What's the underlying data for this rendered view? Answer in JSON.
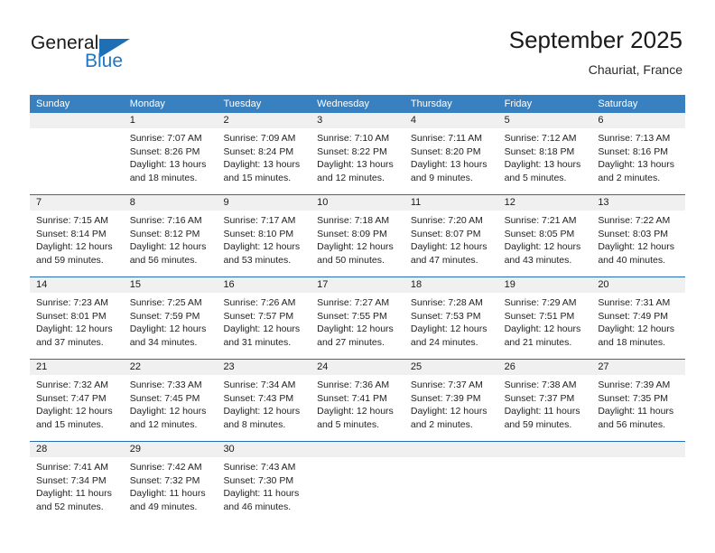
{
  "brand": {
    "name_top": "General",
    "name_bottom": "Blue",
    "triangle_icon": "blue-triangle-icon",
    "accent_color": "#2076c4"
  },
  "header": {
    "title": "September 2025",
    "subtitle": "Chauriat, France"
  },
  "theme": {
    "header_blue": "#3880c0",
    "row_divider_blue": "#2a6db1",
    "daynum_band": "#f0f0f0"
  },
  "weekdays": [
    "Sunday",
    "Monday",
    "Tuesday",
    "Wednesday",
    "Thursday",
    "Friday",
    "Saturday"
  ],
  "weeks": [
    [
      {
        "day": "",
        "sunrise": "",
        "sunset": "",
        "daylight": ""
      },
      {
        "day": "1",
        "sunrise": "Sunrise: 7:07 AM",
        "sunset": "Sunset: 8:26 PM",
        "daylight": "Daylight: 13 hours and 18 minutes."
      },
      {
        "day": "2",
        "sunrise": "Sunrise: 7:09 AM",
        "sunset": "Sunset: 8:24 PM",
        "daylight": "Daylight: 13 hours and 15 minutes."
      },
      {
        "day": "3",
        "sunrise": "Sunrise: 7:10 AM",
        "sunset": "Sunset: 8:22 PM",
        "daylight": "Daylight: 13 hours and 12 minutes."
      },
      {
        "day": "4",
        "sunrise": "Sunrise: 7:11 AM",
        "sunset": "Sunset: 8:20 PM",
        "daylight": "Daylight: 13 hours and 9 minutes."
      },
      {
        "day": "5",
        "sunrise": "Sunrise: 7:12 AM",
        "sunset": "Sunset: 8:18 PM",
        "daylight": "Daylight: 13 hours and 5 minutes."
      },
      {
        "day": "6",
        "sunrise": "Sunrise: 7:13 AM",
        "sunset": "Sunset: 8:16 PM",
        "daylight": "Daylight: 13 hours and 2 minutes."
      }
    ],
    [
      {
        "day": "7",
        "sunrise": "Sunrise: 7:15 AM",
        "sunset": "Sunset: 8:14 PM",
        "daylight": "Daylight: 12 hours and 59 minutes."
      },
      {
        "day": "8",
        "sunrise": "Sunrise: 7:16 AM",
        "sunset": "Sunset: 8:12 PM",
        "daylight": "Daylight: 12 hours and 56 minutes."
      },
      {
        "day": "9",
        "sunrise": "Sunrise: 7:17 AM",
        "sunset": "Sunset: 8:10 PM",
        "daylight": "Daylight: 12 hours and 53 minutes."
      },
      {
        "day": "10",
        "sunrise": "Sunrise: 7:18 AM",
        "sunset": "Sunset: 8:09 PM",
        "daylight": "Daylight: 12 hours and 50 minutes."
      },
      {
        "day": "11",
        "sunrise": "Sunrise: 7:20 AM",
        "sunset": "Sunset: 8:07 PM",
        "daylight": "Daylight: 12 hours and 47 minutes."
      },
      {
        "day": "12",
        "sunrise": "Sunrise: 7:21 AM",
        "sunset": "Sunset: 8:05 PM",
        "daylight": "Daylight: 12 hours and 43 minutes."
      },
      {
        "day": "13",
        "sunrise": "Sunrise: 7:22 AM",
        "sunset": "Sunset: 8:03 PM",
        "daylight": "Daylight: 12 hours and 40 minutes."
      }
    ],
    [
      {
        "day": "14",
        "sunrise": "Sunrise: 7:23 AM",
        "sunset": "Sunset: 8:01 PM",
        "daylight": "Daylight: 12 hours and 37 minutes."
      },
      {
        "day": "15",
        "sunrise": "Sunrise: 7:25 AM",
        "sunset": "Sunset: 7:59 PM",
        "daylight": "Daylight: 12 hours and 34 minutes."
      },
      {
        "day": "16",
        "sunrise": "Sunrise: 7:26 AM",
        "sunset": "Sunset: 7:57 PM",
        "daylight": "Daylight: 12 hours and 31 minutes."
      },
      {
        "day": "17",
        "sunrise": "Sunrise: 7:27 AM",
        "sunset": "Sunset: 7:55 PM",
        "daylight": "Daylight: 12 hours and 27 minutes."
      },
      {
        "day": "18",
        "sunrise": "Sunrise: 7:28 AM",
        "sunset": "Sunset: 7:53 PM",
        "daylight": "Daylight: 12 hours and 24 minutes."
      },
      {
        "day": "19",
        "sunrise": "Sunrise: 7:29 AM",
        "sunset": "Sunset: 7:51 PM",
        "daylight": "Daylight: 12 hours and 21 minutes."
      },
      {
        "day": "20",
        "sunrise": "Sunrise: 7:31 AM",
        "sunset": "Sunset: 7:49 PM",
        "daylight": "Daylight: 12 hours and 18 minutes."
      }
    ],
    [
      {
        "day": "21",
        "sunrise": "Sunrise: 7:32 AM",
        "sunset": "Sunset: 7:47 PM",
        "daylight": "Daylight: 12 hours and 15 minutes."
      },
      {
        "day": "22",
        "sunrise": "Sunrise: 7:33 AM",
        "sunset": "Sunset: 7:45 PM",
        "daylight": "Daylight: 12 hours and 12 minutes."
      },
      {
        "day": "23",
        "sunrise": "Sunrise: 7:34 AM",
        "sunset": "Sunset: 7:43 PM",
        "daylight": "Daylight: 12 hours and 8 minutes."
      },
      {
        "day": "24",
        "sunrise": "Sunrise: 7:36 AM",
        "sunset": "Sunset: 7:41 PM",
        "daylight": "Daylight: 12 hours and 5 minutes."
      },
      {
        "day": "25",
        "sunrise": "Sunrise: 7:37 AM",
        "sunset": "Sunset: 7:39 PM",
        "daylight": "Daylight: 12 hours and 2 minutes."
      },
      {
        "day": "26",
        "sunrise": "Sunrise: 7:38 AM",
        "sunset": "Sunset: 7:37 PM",
        "daylight": "Daylight: 11 hours and 59 minutes."
      },
      {
        "day": "27",
        "sunrise": "Sunrise: 7:39 AM",
        "sunset": "Sunset: 7:35 PM",
        "daylight": "Daylight: 11 hours and 56 minutes."
      }
    ],
    [
      {
        "day": "28",
        "sunrise": "Sunrise: 7:41 AM",
        "sunset": "Sunset: 7:34 PM",
        "daylight": "Daylight: 11 hours and 52 minutes."
      },
      {
        "day": "29",
        "sunrise": "Sunrise: 7:42 AM",
        "sunset": "Sunset: 7:32 PM",
        "daylight": "Daylight: 11 hours and 49 minutes."
      },
      {
        "day": "30",
        "sunrise": "Sunrise: 7:43 AM",
        "sunset": "Sunset: 7:30 PM",
        "daylight": "Daylight: 11 hours and 46 minutes."
      },
      {
        "day": "",
        "sunrise": "",
        "sunset": "",
        "daylight": ""
      },
      {
        "day": "",
        "sunrise": "",
        "sunset": "",
        "daylight": ""
      },
      {
        "day": "",
        "sunrise": "",
        "sunset": "",
        "daylight": ""
      },
      {
        "day": "",
        "sunrise": "",
        "sunset": "",
        "daylight": ""
      }
    ]
  ]
}
